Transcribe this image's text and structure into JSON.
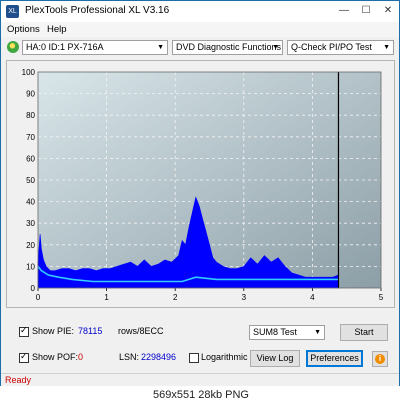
{
  "window": {
    "title": "PlexTools Professional XL V3.16",
    "icon_label": "XL"
  },
  "controls": {
    "minimize": "—",
    "maximize": "☐",
    "close": "✕"
  },
  "menu": {
    "items": [
      "Options",
      "Help"
    ]
  },
  "toolbar": {
    "drive": "HA:0 ID:1  PX-716A",
    "function": "DVD Diagnostic Functions",
    "test": "Q-Check PI/PO Test",
    "drive_icon": "drive-disc-icon"
  },
  "chart_data": {
    "type": "area",
    "title": "",
    "xlabel": "",
    "ylabel": "",
    "ylim": [
      0,
      100
    ],
    "xlim": [
      0,
      5
    ],
    "y_ticks": [
      "0",
      "10",
      "20",
      "30",
      "40",
      "50",
      "60",
      "70",
      "80",
      "90",
      "100"
    ],
    "x_ticks": [
      "0",
      "1",
      "2",
      "3",
      "4",
      "5"
    ],
    "grid": true,
    "end_marker_x": 4.38,
    "series": [
      {
        "values": [
          [
            0.0,
            12
          ],
          [
            0.03,
            25
          ],
          [
            0.05,
            18
          ],
          [
            0.08,
            13
          ],
          [
            0.12,
            10
          ],
          [
            0.18,
            8
          ],
          [
            0.25,
            8
          ],
          [
            0.35,
            9
          ],
          [
            0.45,
            9
          ],
          [
            0.55,
            8
          ],
          [
            0.65,
            9
          ],
          [
            0.75,
            9
          ],
          [
            0.85,
            8
          ],
          [
            0.95,
            9
          ],
          [
            1.05,
            9
          ],
          [
            1.15,
            10
          ],
          [
            1.25,
            11
          ],
          [
            1.35,
            12
          ],
          [
            1.45,
            10
          ],
          [
            1.55,
            13
          ],
          [
            1.65,
            10
          ],
          [
            1.75,
            11
          ],
          [
            1.85,
            13
          ],
          [
            1.95,
            12
          ],
          [
            2.05,
            15
          ],
          [
            2.1,
            22
          ],
          [
            2.15,
            20
          ],
          [
            2.2,
            28
          ],
          [
            2.25,
            35
          ],
          [
            2.3,
            42
          ],
          [
            2.35,
            38
          ],
          [
            2.4,
            32
          ],
          [
            2.45,
            26
          ],
          [
            2.5,
            20
          ],
          [
            2.55,
            14
          ],
          [
            2.6,
            12
          ],
          [
            2.7,
            10
          ],
          [
            2.8,
            9
          ],
          [
            2.9,
            9
          ],
          [
            3.0,
            10
          ],
          [
            3.1,
            14
          ],
          [
            3.2,
            11
          ],
          [
            3.3,
            15
          ],
          [
            3.4,
            12
          ],
          [
            3.5,
            14
          ],
          [
            3.6,
            10
          ],
          [
            3.7,
            7
          ],
          [
            3.8,
            6
          ],
          [
            3.9,
            5
          ],
          [
            4.0,
            5
          ],
          [
            4.1,
            5
          ],
          [
            4.2,
            5
          ],
          [
            4.3,
            5
          ],
          [
            4.38,
            6
          ]
        ],
        "color": "#0000ff"
      },
      {
        "values": [
          [
            0.0,
            10
          ],
          [
            0.05,
            8
          ],
          [
            0.15,
            6
          ],
          [
            0.3,
            5
          ],
          [
            0.5,
            4
          ],
          [
            0.8,
            3
          ],
          [
            1.0,
            3
          ],
          [
            1.3,
            3
          ],
          [
            1.6,
            3
          ],
          [
            1.9,
            3
          ],
          [
            2.1,
            3
          ],
          [
            2.2,
            4
          ],
          [
            2.3,
            5
          ],
          [
            2.45,
            4.5
          ],
          [
            2.6,
            4
          ],
          [
            2.8,
            4
          ],
          [
            3.0,
            4
          ],
          [
            3.3,
            4
          ],
          [
            3.6,
            4
          ],
          [
            3.8,
            4
          ],
          [
            4.1,
            4
          ],
          [
            4.38,
            4
          ]
        ],
        "color": "#33ccff"
      }
    ]
  },
  "bottom": {
    "show_pie_label": "Show PIE:",
    "pie_value": "78115",
    "rows_label": "rows/8ECC",
    "show_pof_label": "Show POF:",
    "pof_value": "0",
    "lsn_label": "LSN:",
    "lsn_value": "2298496",
    "logarithmic_label": "Logarithmic",
    "sum_select": "SUM8 Test",
    "start_label": "Start",
    "view_log_label": "View Log",
    "preferences_label": "Preferences",
    "help_icon": "info-icon",
    "value_color": "#0000cc",
    "zero_color": "#cc0000"
  },
  "status": {
    "text": "Ready",
    "color": "#cc0000"
  },
  "caption": {
    "text": "569x551  28kb  PNG"
  }
}
